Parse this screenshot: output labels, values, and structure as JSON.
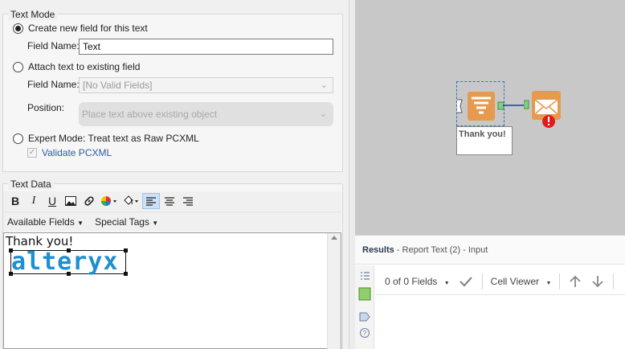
{
  "text_mode": {
    "title": "Text Mode",
    "create_option": "Create new field for this text",
    "field_name_label": "Field Name:",
    "field_name_value": "Text",
    "attach_option": "Attach text to existing field",
    "field_name_label2": "Field Name:",
    "field_select_value": "[No Valid Fields]",
    "position_label": "Position:",
    "position_value": "Place text above existing object",
    "expert_option": "Expert Mode: Treat text as Raw PCXML",
    "validate_label": "Validate PCXML"
  },
  "text_data": {
    "title": "Text Data",
    "toolbar": {
      "bold": "B",
      "italic": "I",
      "underline": "U"
    },
    "available_fields": "Available Fields",
    "special_tags": "Special Tags",
    "editor_text": "Thank you!",
    "logo_text": "alteryx"
  },
  "canvas": {
    "node_label": "Thank you!"
  },
  "results": {
    "title": "Results",
    "subtitle": " - Report Text (2) - Input",
    "fields_count": "0 of 0 Fields",
    "cell_viewer": "Cell Viewer"
  },
  "colors": {
    "accent_blue": "#1e8fd0",
    "tool_orange": "#e59a4f",
    "error_red": "#e31b1b",
    "connector_green": "#7bd47b"
  }
}
